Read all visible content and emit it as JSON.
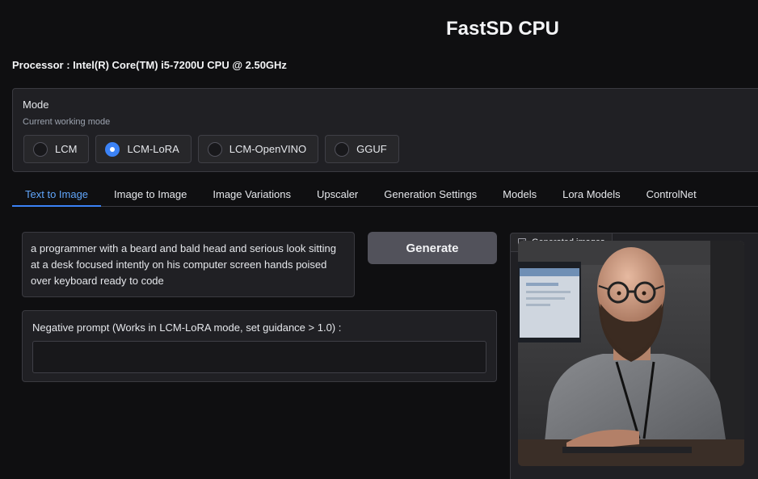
{
  "app": {
    "title": "FastSD CPU",
    "processor": "Processor : Intel(R) Core(TM) i5-7200U CPU @ 2.50GHz"
  },
  "mode": {
    "label": "Mode",
    "info": "Current working mode",
    "options": [
      "LCM",
      "LCM-LoRA",
      "LCM-OpenVINO",
      "GGUF"
    ],
    "selected": "LCM-LoRA"
  },
  "tabs": [
    "Text to Image",
    "Image to Image",
    "Image Variations",
    "Upscaler",
    "Generation Settings",
    "Models",
    "Lora Models",
    "ControlNet"
  ],
  "active_tab": "Text to Image",
  "text_to_image": {
    "prompt": "a programmer with a beard and bald head and serious look sitting at a desk focused intently on his computer screen hands poised over keyboard ready to code",
    "generate_label": "Generate",
    "negative_prompt_label": "Negative prompt (Works in LCM-LoRA mode, set guidance > 1.0) :",
    "negative_prompt_value": "",
    "gallery_label": "Generated images",
    "image_icon": "image-icon"
  },
  "colors": {
    "accent": "#3b82f6",
    "background": "#0f0f11",
    "panel": "#202024"
  }
}
